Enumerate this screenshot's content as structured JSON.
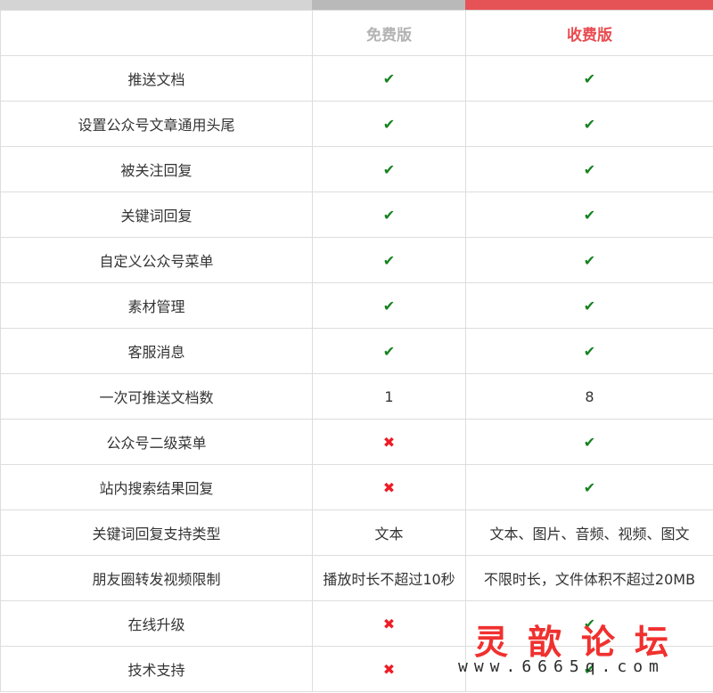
{
  "header": {
    "free_label": "免费版",
    "paid_label": "收费版"
  },
  "rows": [
    {
      "feature": "推送文档",
      "free": "✔",
      "paid": "✔"
    },
    {
      "feature": "设置公众号文章通用头尾",
      "free": "✔",
      "paid": "✔"
    },
    {
      "feature": "被关注回复",
      "free": "✔",
      "paid": "✔"
    },
    {
      "feature": "关键词回复",
      "free": "✔",
      "paid": "✔"
    },
    {
      "feature": "自定义公众号菜单",
      "free": "✔",
      "paid": "✔"
    },
    {
      "feature": "素材管理",
      "free": "✔",
      "paid": "✔"
    },
    {
      "feature": "客服消息",
      "free": "✔",
      "paid": "✔"
    },
    {
      "feature": "一次可推送文档数",
      "free": "1",
      "paid": "8"
    },
    {
      "feature": "公众号二级菜单",
      "free": "✖",
      "paid": "✔"
    },
    {
      "feature": "站内搜索结果回复",
      "free": "✖",
      "paid": "✔"
    },
    {
      "feature": "关键词回复支持类型",
      "free": "文本",
      "paid": "文本、图片、音频、视频、图文"
    },
    {
      "feature": "朋友圈转发视频限制",
      "free": "播放时长不超过10秒",
      "paid": "不限时长，文件体积不超过20MB"
    },
    {
      "feature": "在线升级",
      "free": "✖",
      "paid": "✔"
    },
    {
      "feature": "技术支持",
      "free": "✖",
      "paid": "✔"
    }
  ],
  "watermark": {
    "title": "灵歆论坛",
    "url": "www.6665q.com"
  },
  "colors": {
    "free_header": "#b3b3b3",
    "paid_header": "#e94a4f",
    "check": "#15821f",
    "cross": "#ee1c25",
    "paid_bar": "#e65357"
  }
}
